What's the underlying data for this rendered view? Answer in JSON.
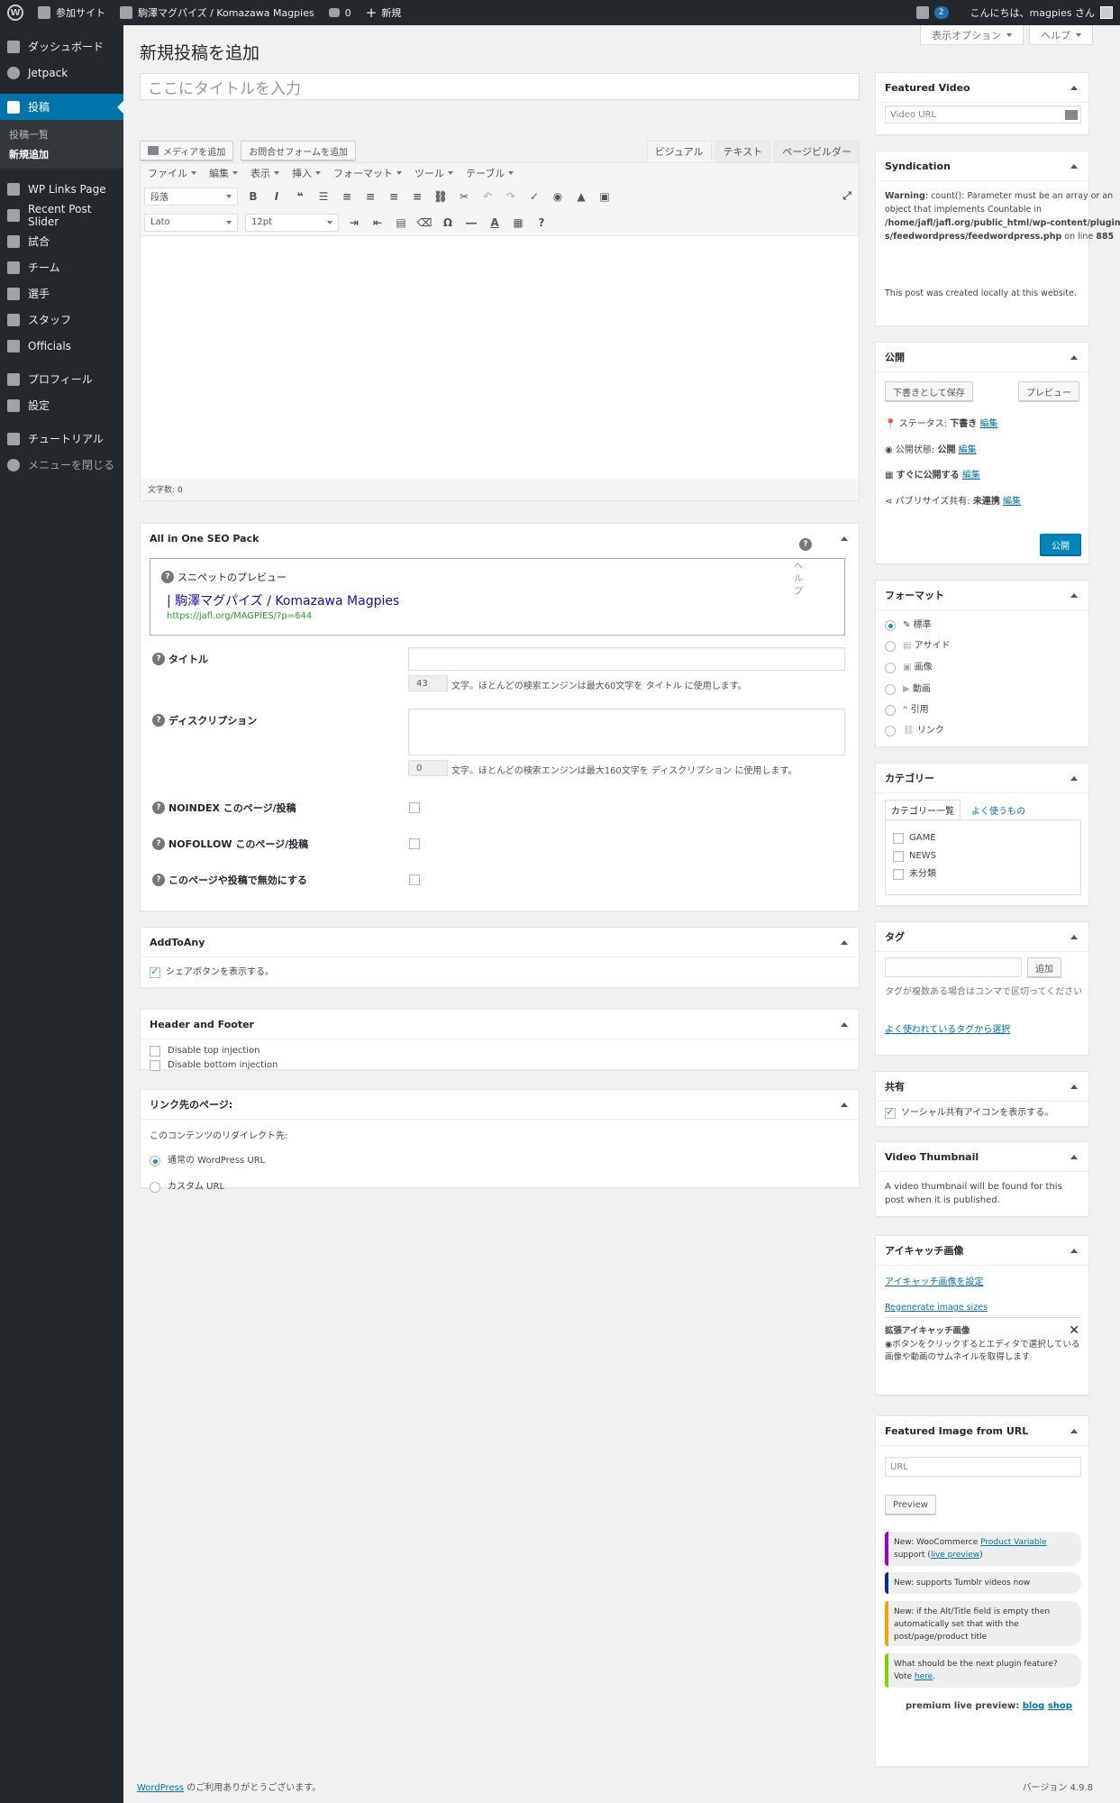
{
  "adminbar": {
    "site_label": "参加サイト",
    "site_name": "駒澤マグパイズ / Komazawa Magpies",
    "comments_count": "0",
    "new_label": "新規",
    "updates_count": "2",
    "greeting": "こんにちは、magpies さん"
  },
  "sidebar": {
    "items": [
      {
        "label": "ダッシュボード",
        "icon": "dashboard-icon"
      },
      {
        "label": "Jetpack",
        "icon": "jetpack-icon"
      },
      {
        "label": "投稿",
        "icon": "pin-icon"
      },
      {
        "label": "WP Links Page",
        "icon": "link-icon"
      },
      {
        "label": "Recent Post Slider",
        "icon": "pin-icon"
      },
      {
        "label": "試合",
        "icon": "calendar-icon"
      },
      {
        "label": "チーム",
        "icon": "shield-icon"
      },
      {
        "label": "選手",
        "icon": "shirt-icon"
      },
      {
        "label": "スタッフ",
        "icon": "id-card-icon"
      },
      {
        "label": "Officials",
        "icon": "whistle-icon"
      },
      {
        "label": "プロフィール",
        "icon": "user-icon"
      },
      {
        "label": "設定",
        "icon": "settings-icon"
      },
      {
        "label": "チュートリアル",
        "icon": "video-icon"
      },
      {
        "label": "メニューを閉じる",
        "icon": "collapse-icon"
      }
    ],
    "submenu": [
      "投稿一覧",
      "新規追加"
    ]
  },
  "screen_options": "表示オプション",
  "help": "ヘルプ",
  "page_title": "新規投稿を追加",
  "title_placeholder": "ここにタイトルを入力",
  "media_button": "メディアを追加",
  "form_button": "お問合せフォームを追加",
  "editor_tabs": [
    "ビジュアル",
    "テキスト",
    "ページビルダー"
  ],
  "menubar": [
    "ファイル",
    "編集",
    "表示",
    "挿入",
    "フォーマット",
    "ツール",
    "テーブル"
  ],
  "toolbar": {
    "format_select": "段落",
    "font_select": "Lato",
    "size_select": "12pt"
  },
  "word_count": "文字数: 0",
  "seo": {
    "title": "All in One SEO Pack",
    "help_vertical": "ヘルプ",
    "snippet_label": "スニペットのプレビュー",
    "snippet_title": "| 駒澤マグパイズ / Komazawa Magpies",
    "snippet_url": "https://jafl.org/MAGPIES/?p=644",
    "title_label": "タイトル",
    "title_count": "43",
    "title_hint": "文字。ほとんどの検索エンジンは最大60文字を タイトル に使用します。",
    "desc_label": "ディスクリプション",
    "desc_count": "0",
    "desc_hint": "文字。ほとんどの検索エンジンは最大160文字を ディスクリプション に使用します。",
    "noindex_label": "NOINDEX このページ/投稿",
    "nofollow_label": "NOFOLLOW このページ/投稿",
    "disable_label": "このページや投稿で無効にする"
  },
  "addtoany": {
    "title": "AddToAny",
    "share_label": "シェアボタンを表示する。"
  },
  "header_footer": {
    "title": "Header and Footer",
    "top": "Disable top injection",
    "bottom": "Disable bottom injection"
  },
  "link_page": {
    "title": "リンク先のページ:",
    "desc": "このコンテンツのリダイレクト先:",
    "opt1": "通常の WordPress URL",
    "opt2": "カスタム URL"
  },
  "featured_video": {
    "title": "Featured Video",
    "placeholder": "Video URL"
  },
  "syndication": {
    "title": "Syndication",
    "warning_bold": "Warning",
    "warning_text": ": count(): Parameter must be an array or an object that implements Countable in",
    "path": "/home/jafl/jafl.org/public_html/wp-content/plugins/feedwordpress/feedwordpress.php",
    "line_prefix": "on line",
    "line_no": "885",
    "local_note": "This post was created locally at this website."
  },
  "publish": {
    "title": "公開",
    "save_draft": "下書きとして保存",
    "preview": "プレビュー",
    "status_label": "ステータス:",
    "status_value": "下書き",
    "visibility_label": "公開状態:",
    "visibility_value": "公開",
    "schedule_label": "すぐに公開する",
    "publicize_label": "パブリサイズ共有:",
    "publicize_value": "未連携",
    "edit": "編集",
    "publish_button": "公開"
  },
  "format": {
    "title": "フォーマット",
    "options": [
      "標準",
      "アサイド",
      "画像",
      "動画",
      "引用",
      "リンク"
    ]
  },
  "categories": {
    "title": "カテゴリー",
    "tab_all": "カテゴリー一覧",
    "tab_popular": "よく使うもの",
    "items": [
      "GAME",
      "NEWS",
      "未分類"
    ]
  },
  "tags": {
    "title": "タグ",
    "add": "追加",
    "hint": "タグが複数ある場合はコンマで区切ってください",
    "choose": "よく使われているタグから選択"
  },
  "sharing": {
    "title": "共有",
    "label": "ソーシャル共有アイコンを表示する。"
  },
  "video_thumbnail": {
    "title": "Video Thumbnail",
    "text": "A video thumbnail will be found for this post when it is published."
  },
  "eyecatch": {
    "title": "アイキャッチ画像",
    "set": "アイキャッチ画像を設定",
    "regen": "Regenerate image sizes",
    "ext_title": "拡張アイキャッチ画像",
    "ext_text": "ボタンをクリックするとエディタで選択している画像や動画のサムネイルを取得します"
  },
  "featured_url": {
    "title": "Featured Image from URL",
    "placeholder": "URL",
    "preview": "Preview",
    "n1_prefix": "New: WooCommerce ",
    "n1_link": "Product Variable",
    "n1_suffix": " support (",
    "n1_link2": "live preview",
    "n1_close": ")",
    "n2": "New: supports Tumblr videos now",
    "n3": "New: if the Alt/Title field is empty then automatically set that with the post/page/product title",
    "n4_prefix": "What should be the next plugin feature? Vote ",
    "n4_link": "here",
    "n4_suffix": ".",
    "premium": "premium live preview:",
    "blog": "blog",
    "shop": "shop",
    "colors": [
      "#9b00c8",
      "#0a2a8a",
      "#f0a500",
      "#7fd400"
    ]
  },
  "footer": {
    "link": "WordPress",
    "text": " のご利用ありがとうございます。",
    "version": "バージョン 4.9.8"
  }
}
